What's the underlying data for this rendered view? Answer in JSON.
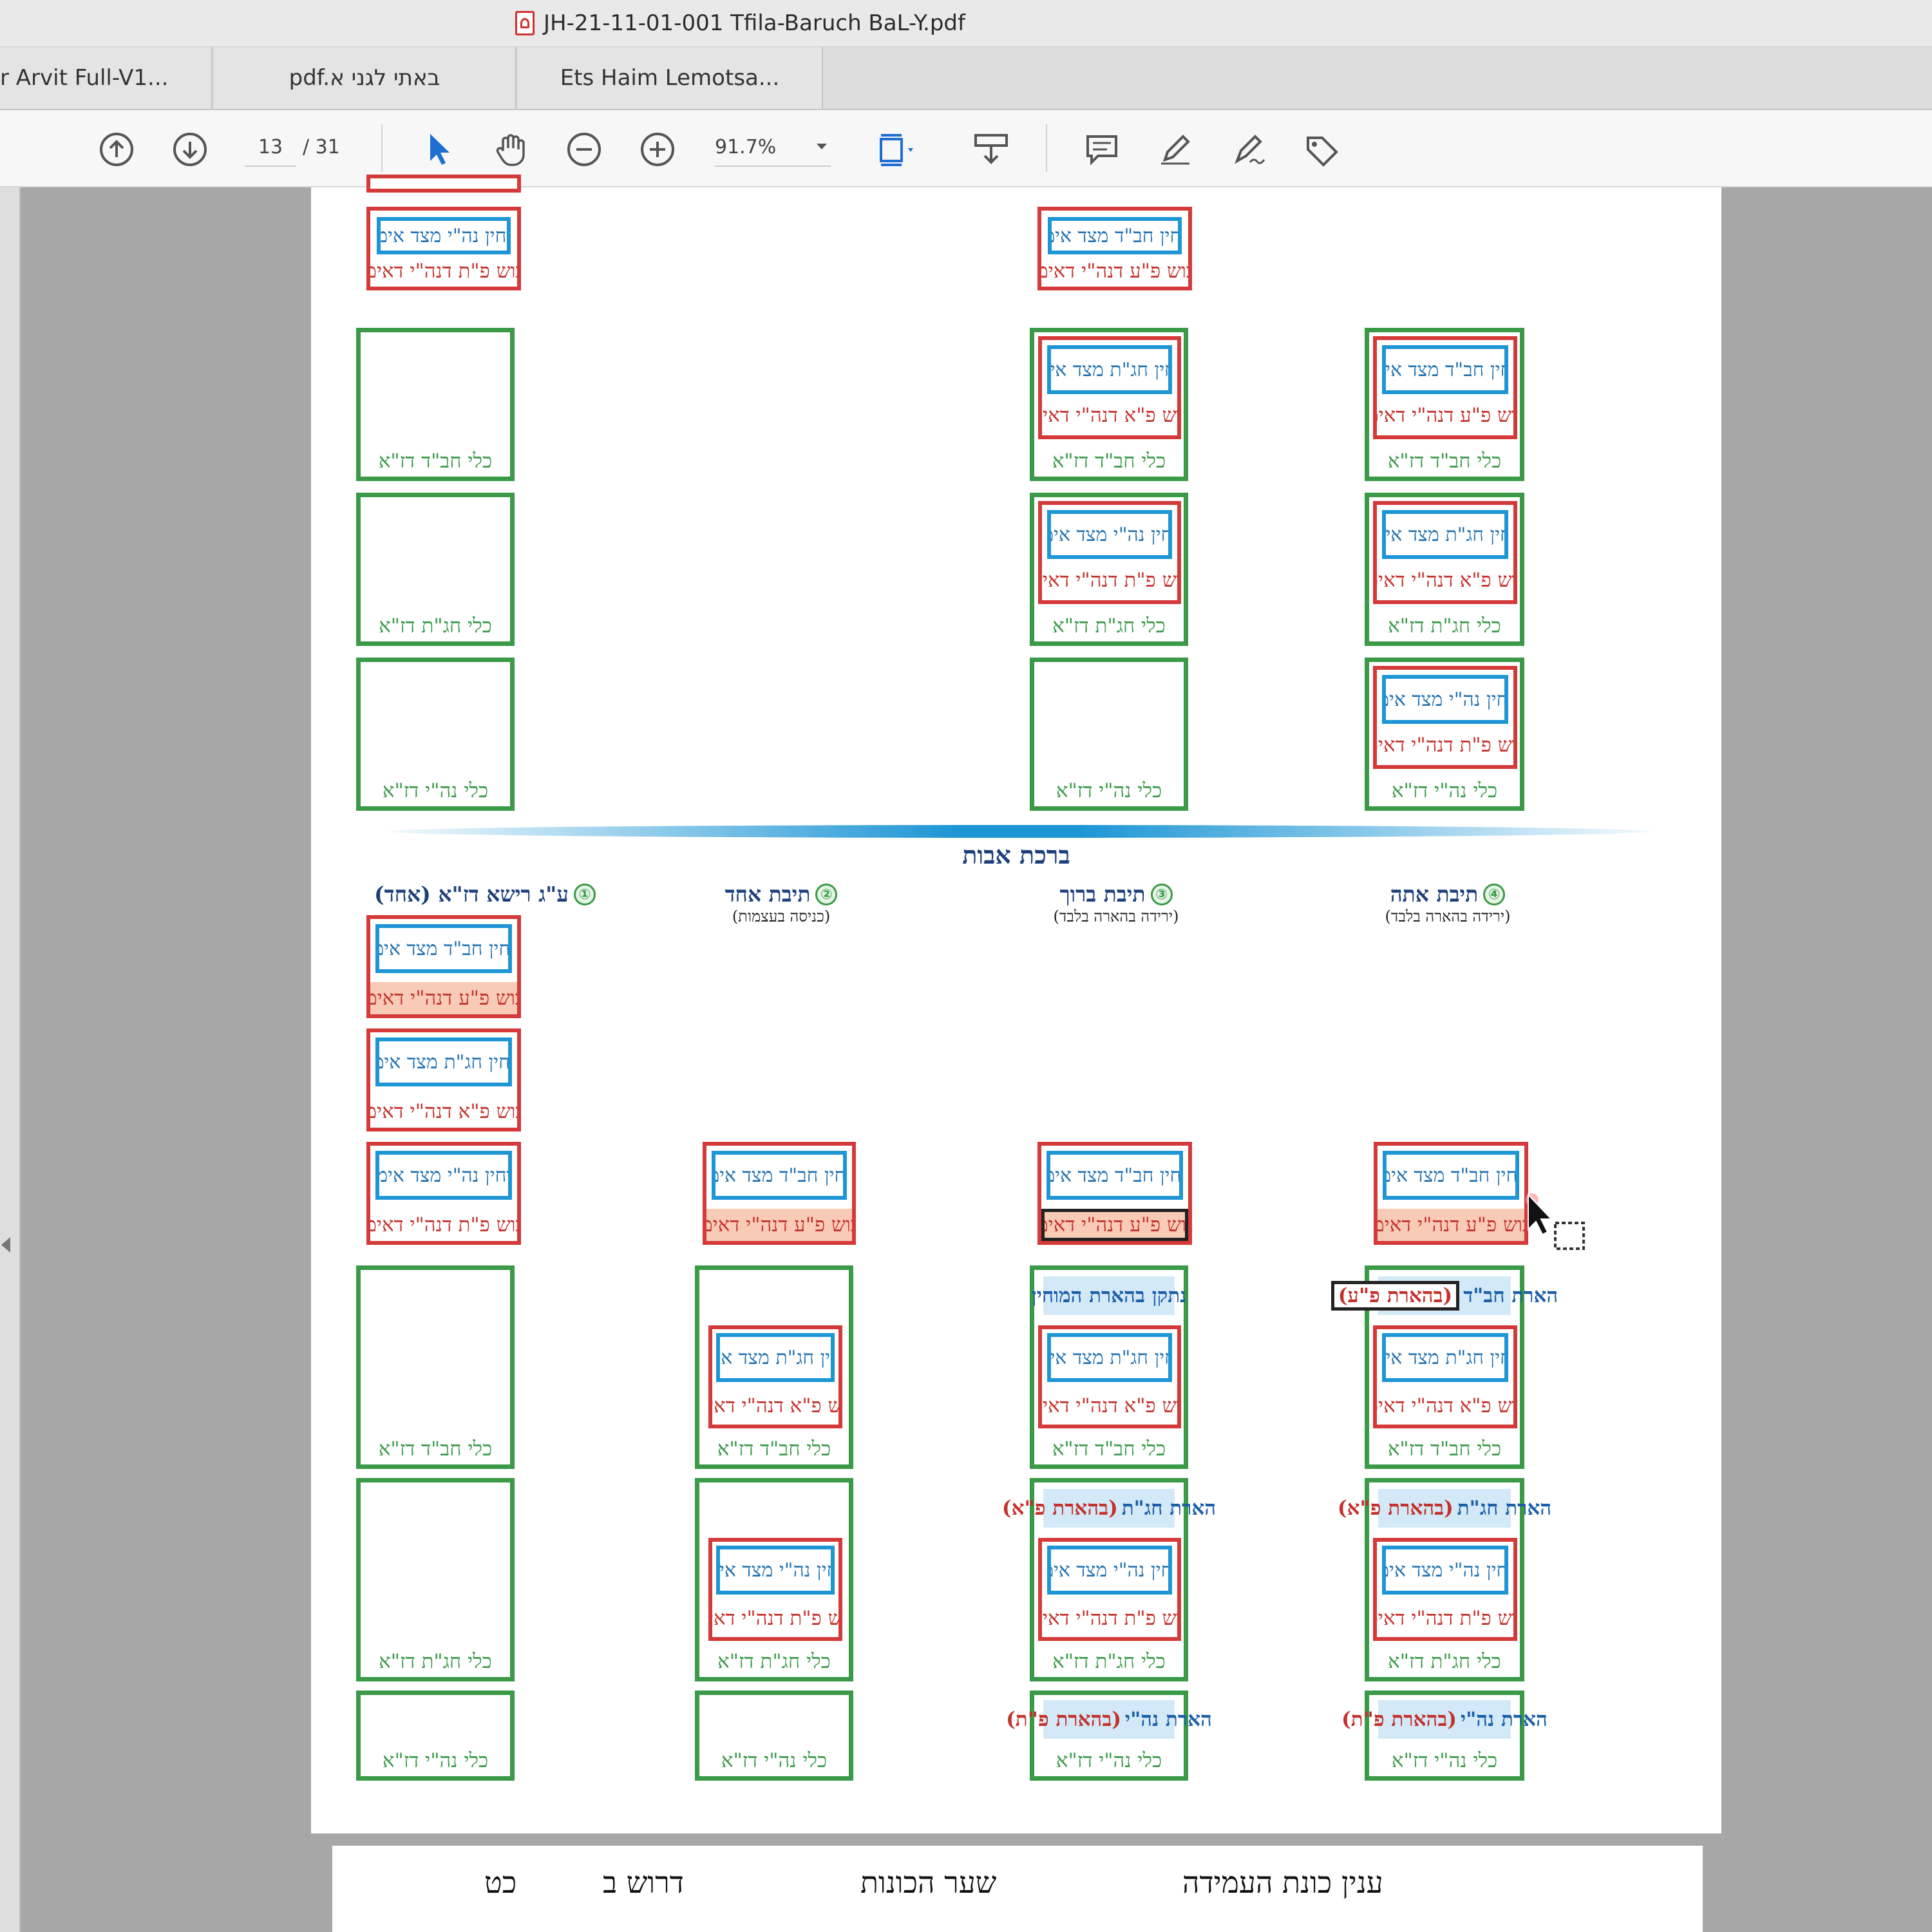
{
  "window": {
    "title": "JH-21-11-01-001 Tfila-Baruch BaL-Y.pdf"
  },
  "tabs": [
    {
      "label": "r Arvit Full-V1..."
    },
    {
      "label": "pdf.באתי לגני א"
    },
    {
      "label": "Ets Haim Lemotsa..."
    }
  ],
  "toolbar": {
    "page_current": "13",
    "page_total": "/ 31",
    "zoom": "91.7%"
  },
  "doc": {
    "section_title": "ברכת אבות",
    "labels": {
      "mochin_chabad": "מוחין חב\"ד מצד אימא",
      "mochin_chagat": "מוחין חג\"ת מצד אימא",
      "mochin_nehi": "מוחין נה\"י מצד אימא",
      "levush_pe_ayin": "לבוש פ\"ע דנה\"י דאימא",
      "levush_pe_alef": "לבוש פ\"א דנה\"י דאימא",
      "levush_pe_tav": "לבוש פ\"ת דנה\"י דאימא",
      "kli_chabad": "כלי חב\"ד דז\"א",
      "kli_chagat": "כלי חג\"ת דז\"א",
      "kli_nehi": "כלי נה\"י דז\"א"
    },
    "columns": [
      {
        "num": "④",
        "title": "תיבת אתה",
        "sub": "(ירידה בהארה בלבד)"
      },
      {
        "num": "③",
        "title": "תיבת ברוך",
        "sub": "(ירידה בהארה בלבד)"
      },
      {
        "num": "②",
        "title": "תיבת אחד",
        "sub": "(כניסה בעצמות)"
      },
      {
        "num": "①",
        "title": "ע\"ג רישא דז\"א (אחד)",
        "sub": ""
      }
    ],
    "highlights": {
      "c4_chabad_main": "הארת חב\"ד",
      "c4_chabad_sub": "(בהארת פ\"ע)",
      "c3_chabad": "נתקן בהארת המוחין",
      "c4_chagat_main": "הארת חג\"ת",
      "c4_chagat_sub": "(בהארת פ\"א)",
      "c3_chagat_main": "הארת חג\"ת",
      "c3_chagat_sub": "(בהארת פ\"א)",
      "c4_nehi_main": "הארת נה\"י",
      "c4_nehi_sub": "(בהארת פ\"ת)",
      "c3_nehi_main": "הארת נה\"י",
      "c3_nehi_sub": "(בהארת פ\"ת)"
    },
    "footer": {
      "right": "ענין כונת העמידה",
      "center": "שער הכונות",
      "left_a": "דרוש ב",
      "left_b": "כט"
    }
  },
  "icons": [
    "prev-page-icon",
    "next-page-icon",
    "select-arrow-icon",
    "hand-tool-icon",
    "zoom-out-icon",
    "zoom-in-icon",
    "fit-page-icon",
    "scroll-mode-icon",
    "comment-icon",
    "highlight-pen-icon",
    "sign-icon",
    "more-tools-icon",
    "pdf-file-icon"
  ],
  "colors": {
    "green": "#3a9a48",
    "red": "#d53a3a",
    "blue": "#1e96d6",
    "highlight": "#d3e9f7",
    "fill": "#f8cbb6"
  }
}
